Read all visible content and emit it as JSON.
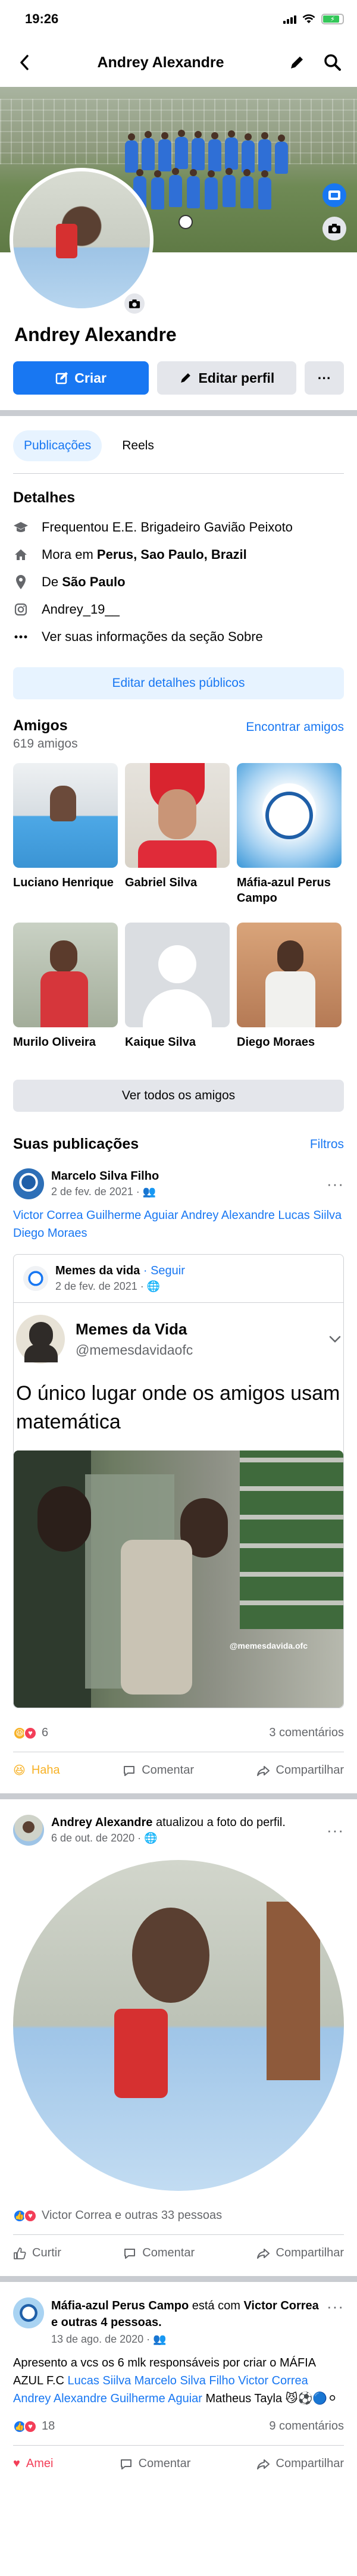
{
  "status_bar": {
    "time": "19:26"
  },
  "nav": {
    "title": "Andrey Alexandre"
  },
  "profile": {
    "name": "Andrey Alexandre",
    "create_label": "Criar",
    "edit_label": "Editar perfil",
    "more_label": "···"
  },
  "tabs": [
    {
      "label": "Publicações",
      "active": true
    },
    {
      "label": "Reels",
      "active": false
    }
  ],
  "details": {
    "title": "Detalhes",
    "items": [
      {
        "icon": "graduation-cap-icon",
        "text": "Frequentou E.E. Brigadeiro Gavião Peixoto"
      },
      {
        "icon": "home-icon",
        "prefix": "Mora em ",
        "bold": "Perus, Sao Paulo, Brazil"
      },
      {
        "icon": "location-pin-icon",
        "prefix": "De ",
        "bold": "São Paulo"
      },
      {
        "icon": "instagram-icon",
        "text": "Andrey_19__"
      },
      {
        "icon": "more-dots-icon",
        "text": "Ver suas informações da seção Sobre"
      }
    ],
    "edit_public": "Editar detalhes públicos"
  },
  "friends": {
    "title": "Amigos",
    "find_label": "Encontrar amigos",
    "count": "619 amigos",
    "list": [
      {
        "name": "Luciano Henrique"
      },
      {
        "name": "Gabriel Silva"
      },
      {
        "name": "Máfia-azul Perus Campo"
      },
      {
        "name": "Murilo Oliveira"
      },
      {
        "name": "Kaique Silva"
      },
      {
        "name": "Diego Moraes"
      }
    ],
    "see_all": "Ver todos os amigos"
  },
  "publications": {
    "title": "Suas publicações",
    "filters_label": "Filtros"
  },
  "post1": {
    "author": "Marcelo Silva Filho",
    "date": "2 de fev. de 2021 ·",
    "tags": "Victor Correa  Guilherme Aguiar Andrey Alexandre Lucas Siilva Diego Moraes",
    "shared_author": "Memes da vida",
    "shared_follow": "· Seguir",
    "shared_date": "2 de fev. de 2021 ·",
    "source_name": "Memes da Vida",
    "source_handle": "@memesdavidaofc",
    "source_text": "O único lugar onde os amigos usam matemática",
    "watermark": "@memesdavida.ofc",
    "reaction_count": "6",
    "comments": "3 comentários",
    "reaction_label": "Haha",
    "comment_label": "Comentar",
    "share_label": "Compartilhar"
  },
  "post2": {
    "author": "Andrey Alexandre",
    "action": " atualizou a foto do perfil.",
    "date": "6 de out. de 2020 ·",
    "reactions": "Victor Correa e outras 33 pessoas",
    "like_label": "Curtir",
    "comment_label": "Comentar",
    "share_label": "Compartilhar"
  },
  "post3": {
    "author": "Máfia-azul Perus Campo",
    "mid": " está com ",
    "with1": "Victor Correa",
    "with_rest": " e outras 4 pessoas.",
    "date": "13 de ago. de 2020 ·",
    "text_a": "Apresento a vcs os 6 mlk responsáveis por criar o MÁFIA AZUL F.C ",
    "tags": "Lucas Siilva Marcelo Silva Filho Victor Correa Andrey Alexandre Guilherme Aguiar",
    "text_b": " Matheus Tayla 😼⚽🔵⚪",
    "reaction_count": "18",
    "comments": "9 comentários",
    "reaction_label": "Amei",
    "comment_label": "Comentar",
    "share_label": "Compartilhar"
  },
  "colors": {
    "accent": "#1877f2",
    "haha": "#f7b125",
    "love": "#f33e58",
    "divider": "#c9ccd1"
  }
}
